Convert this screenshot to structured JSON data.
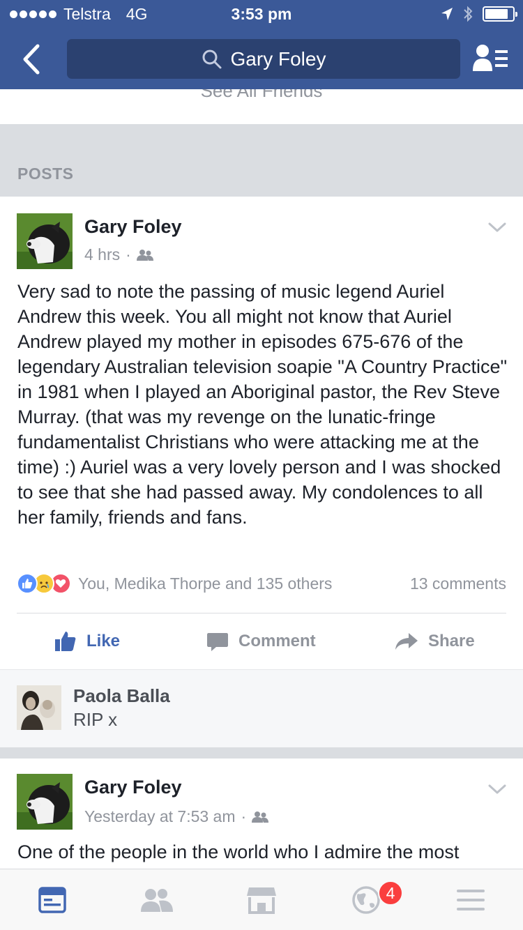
{
  "status_bar": {
    "carrier": "Telstra",
    "network": "4G",
    "time": "3:53 pm",
    "battery_level": 0.85
  },
  "nav": {
    "search_query": "Gary Foley",
    "accent_color": "#3b5998"
  },
  "profile": {
    "see_all_friends": "See All Friends",
    "posts_section_label": "POSTS"
  },
  "posts": [
    {
      "author": "Gary Foley",
      "time": "4 hrs",
      "dot": "·",
      "audience_icon": "friends-icon",
      "text": "Very sad to note the passing of music legend Auriel Andrew this week. You all might not know that Auriel Andrew played my mother in episodes 675-676 of the legendary Australian television soapie \"A Country Practice\" in 1981 when I played an Aboriginal pastor, the Rev Steve Murray. (that was my revenge on the lunatic-fringe fundamentalist Christians who were attacking me at the time) :) Auriel was a very lovely person and I was shocked to see that she had passed away. My condolences to all her family, friends and fans.",
      "reactions_summary": "You, Medika Thorpe and 135 others",
      "comments_count": "13 comments",
      "actions": {
        "like": "Like",
        "comment": "Comment",
        "share": "Share"
      },
      "top_comment": {
        "author": "Paola Balla",
        "text": "RIP x"
      }
    },
    {
      "author": "Gary Foley",
      "time": "Yesterday at 7:53 am",
      "dot": "·",
      "audience_icon": "friends-icon",
      "text": "One of the people in the world who I admire the most"
    }
  ],
  "tabbar": {
    "notifications_badge": "4",
    "active_tab": "news-feed"
  }
}
